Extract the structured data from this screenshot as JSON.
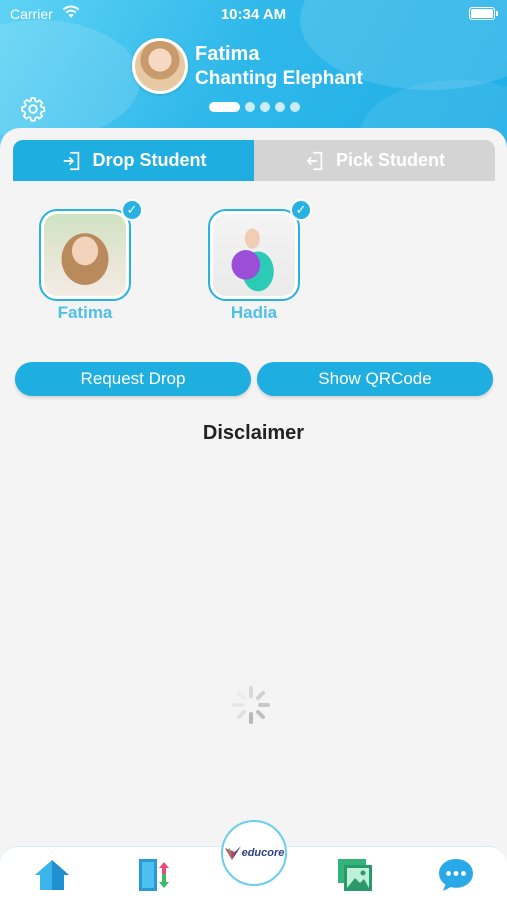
{
  "status_bar": {
    "carrier": "Carrier",
    "time": "10:34 AM"
  },
  "profile": {
    "name": "Fatima",
    "subtitle": "Chanting Elephant",
    "page_dots": 5,
    "active_dot": 1
  },
  "tabs": [
    {
      "label": "Drop Student",
      "active": true
    },
    {
      "label": "Pick Student",
      "active": false
    }
  ],
  "students": [
    {
      "name": "Fatima",
      "selected": true
    },
    {
      "name": "Hadia",
      "selected": true
    }
  ],
  "actions": {
    "request_drop": "Request Drop",
    "show_qrcode": "Show QRCode"
  },
  "disclaimer": "Disclaimer",
  "brand": {
    "logo_text": "educore",
    "accent": "#1eaedf"
  },
  "bottom_nav": {
    "items": [
      "home-icon",
      "pickup-drop-icon",
      "educore-logo",
      "gallery-icon",
      "chat-icon"
    ]
  }
}
